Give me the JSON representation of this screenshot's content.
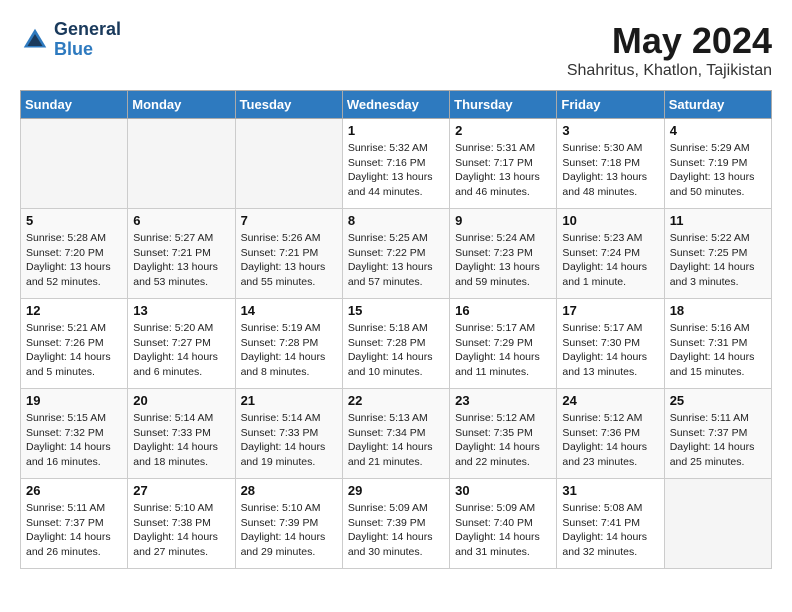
{
  "header": {
    "logo_general": "General",
    "logo_blue": "Blue",
    "month_year": "May 2024",
    "location": "Shahritus, Khatlon, Tajikistan"
  },
  "weekdays": [
    "Sunday",
    "Monday",
    "Tuesday",
    "Wednesday",
    "Thursday",
    "Friday",
    "Saturday"
  ],
  "weeks": [
    [
      {
        "day": "",
        "sunrise": "",
        "sunset": "",
        "daylight": "",
        "empty": true
      },
      {
        "day": "",
        "sunrise": "",
        "sunset": "",
        "daylight": "",
        "empty": true
      },
      {
        "day": "",
        "sunrise": "",
        "sunset": "",
        "daylight": "",
        "empty": true
      },
      {
        "day": "1",
        "sunrise": "Sunrise: 5:32 AM",
        "sunset": "Sunset: 7:16 PM",
        "daylight": "Daylight: 13 hours and 44 minutes."
      },
      {
        "day": "2",
        "sunrise": "Sunrise: 5:31 AM",
        "sunset": "Sunset: 7:17 PM",
        "daylight": "Daylight: 13 hours and 46 minutes."
      },
      {
        "day": "3",
        "sunrise": "Sunrise: 5:30 AM",
        "sunset": "Sunset: 7:18 PM",
        "daylight": "Daylight: 13 hours and 48 minutes."
      },
      {
        "day": "4",
        "sunrise": "Sunrise: 5:29 AM",
        "sunset": "Sunset: 7:19 PM",
        "daylight": "Daylight: 13 hours and 50 minutes."
      }
    ],
    [
      {
        "day": "5",
        "sunrise": "Sunrise: 5:28 AM",
        "sunset": "Sunset: 7:20 PM",
        "daylight": "Daylight: 13 hours and 52 minutes."
      },
      {
        "day": "6",
        "sunrise": "Sunrise: 5:27 AM",
        "sunset": "Sunset: 7:21 PM",
        "daylight": "Daylight: 13 hours and 53 minutes."
      },
      {
        "day": "7",
        "sunrise": "Sunrise: 5:26 AM",
        "sunset": "Sunset: 7:21 PM",
        "daylight": "Daylight: 13 hours and 55 minutes."
      },
      {
        "day": "8",
        "sunrise": "Sunrise: 5:25 AM",
        "sunset": "Sunset: 7:22 PM",
        "daylight": "Daylight: 13 hours and 57 minutes."
      },
      {
        "day": "9",
        "sunrise": "Sunrise: 5:24 AM",
        "sunset": "Sunset: 7:23 PM",
        "daylight": "Daylight: 13 hours and 59 minutes."
      },
      {
        "day": "10",
        "sunrise": "Sunrise: 5:23 AM",
        "sunset": "Sunset: 7:24 PM",
        "daylight": "Daylight: 14 hours and 1 minute."
      },
      {
        "day": "11",
        "sunrise": "Sunrise: 5:22 AM",
        "sunset": "Sunset: 7:25 PM",
        "daylight": "Daylight: 14 hours and 3 minutes."
      }
    ],
    [
      {
        "day": "12",
        "sunrise": "Sunrise: 5:21 AM",
        "sunset": "Sunset: 7:26 PM",
        "daylight": "Daylight: 14 hours and 5 minutes."
      },
      {
        "day": "13",
        "sunrise": "Sunrise: 5:20 AM",
        "sunset": "Sunset: 7:27 PM",
        "daylight": "Daylight: 14 hours and 6 minutes."
      },
      {
        "day": "14",
        "sunrise": "Sunrise: 5:19 AM",
        "sunset": "Sunset: 7:28 PM",
        "daylight": "Daylight: 14 hours and 8 minutes."
      },
      {
        "day": "15",
        "sunrise": "Sunrise: 5:18 AM",
        "sunset": "Sunset: 7:28 PM",
        "daylight": "Daylight: 14 hours and 10 minutes."
      },
      {
        "day": "16",
        "sunrise": "Sunrise: 5:17 AM",
        "sunset": "Sunset: 7:29 PM",
        "daylight": "Daylight: 14 hours and 11 minutes."
      },
      {
        "day": "17",
        "sunrise": "Sunrise: 5:17 AM",
        "sunset": "Sunset: 7:30 PM",
        "daylight": "Daylight: 14 hours and 13 minutes."
      },
      {
        "day": "18",
        "sunrise": "Sunrise: 5:16 AM",
        "sunset": "Sunset: 7:31 PM",
        "daylight": "Daylight: 14 hours and 15 minutes."
      }
    ],
    [
      {
        "day": "19",
        "sunrise": "Sunrise: 5:15 AM",
        "sunset": "Sunset: 7:32 PM",
        "daylight": "Daylight: 14 hours and 16 minutes."
      },
      {
        "day": "20",
        "sunrise": "Sunrise: 5:14 AM",
        "sunset": "Sunset: 7:33 PM",
        "daylight": "Daylight: 14 hours and 18 minutes."
      },
      {
        "day": "21",
        "sunrise": "Sunrise: 5:14 AM",
        "sunset": "Sunset: 7:33 PM",
        "daylight": "Daylight: 14 hours and 19 minutes."
      },
      {
        "day": "22",
        "sunrise": "Sunrise: 5:13 AM",
        "sunset": "Sunset: 7:34 PM",
        "daylight": "Daylight: 14 hours and 21 minutes."
      },
      {
        "day": "23",
        "sunrise": "Sunrise: 5:12 AM",
        "sunset": "Sunset: 7:35 PM",
        "daylight": "Daylight: 14 hours and 22 minutes."
      },
      {
        "day": "24",
        "sunrise": "Sunrise: 5:12 AM",
        "sunset": "Sunset: 7:36 PM",
        "daylight": "Daylight: 14 hours and 23 minutes."
      },
      {
        "day": "25",
        "sunrise": "Sunrise: 5:11 AM",
        "sunset": "Sunset: 7:37 PM",
        "daylight": "Daylight: 14 hours and 25 minutes."
      }
    ],
    [
      {
        "day": "26",
        "sunrise": "Sunrise: 5:11 AM",
        "sunset": "Sunset: 7:37 PM",
        "daylight": "Daylight: 14 hours and 26 minutes."
      },
      {
        "day": "27",
        "sunrise": "Sunrise: 5:10 AM",
        "sunset": "Sunset: 7:38 PM",
        "daylight": "Daylight: 14 hours and 27 minutes."
      },
      {
        "day": "28",
        "sunrise": "Sunrise: 5:10 AM",
        "sunset": "Sunset: 7:39 PM",
        "daylight": "Daylight: 14 hours and 29 minutes."
      },
      {
        "day": "29",
        "sunrise": "Sunrise: 5:09 AM",
        "sunset": "Sunset: 7:39 PM",
        "daylight": "Daylight: 14 hours and 30 minutes."
      },
      {
        "day": "30",
        "sunrise": "Sunrise: 5:09 AM",
        "sunset": "Sunset: 7:40 PM",
        "daylight": "Daylight: 14 hours and 31 minutes."
      },
      {
        "day": "31",
        "sunrise": "Sunrise: 5:08 AM",
        "sunset": "Sunset: 7:41 PM",
        "daylight": "Daylight: 14 hours and 32 minutes."
      },
      {
        "day": "",
        "sunrise": "",
        "sunset": "",
        "daylight": "",
        "empty": true
      }
    ]
  ]
}
